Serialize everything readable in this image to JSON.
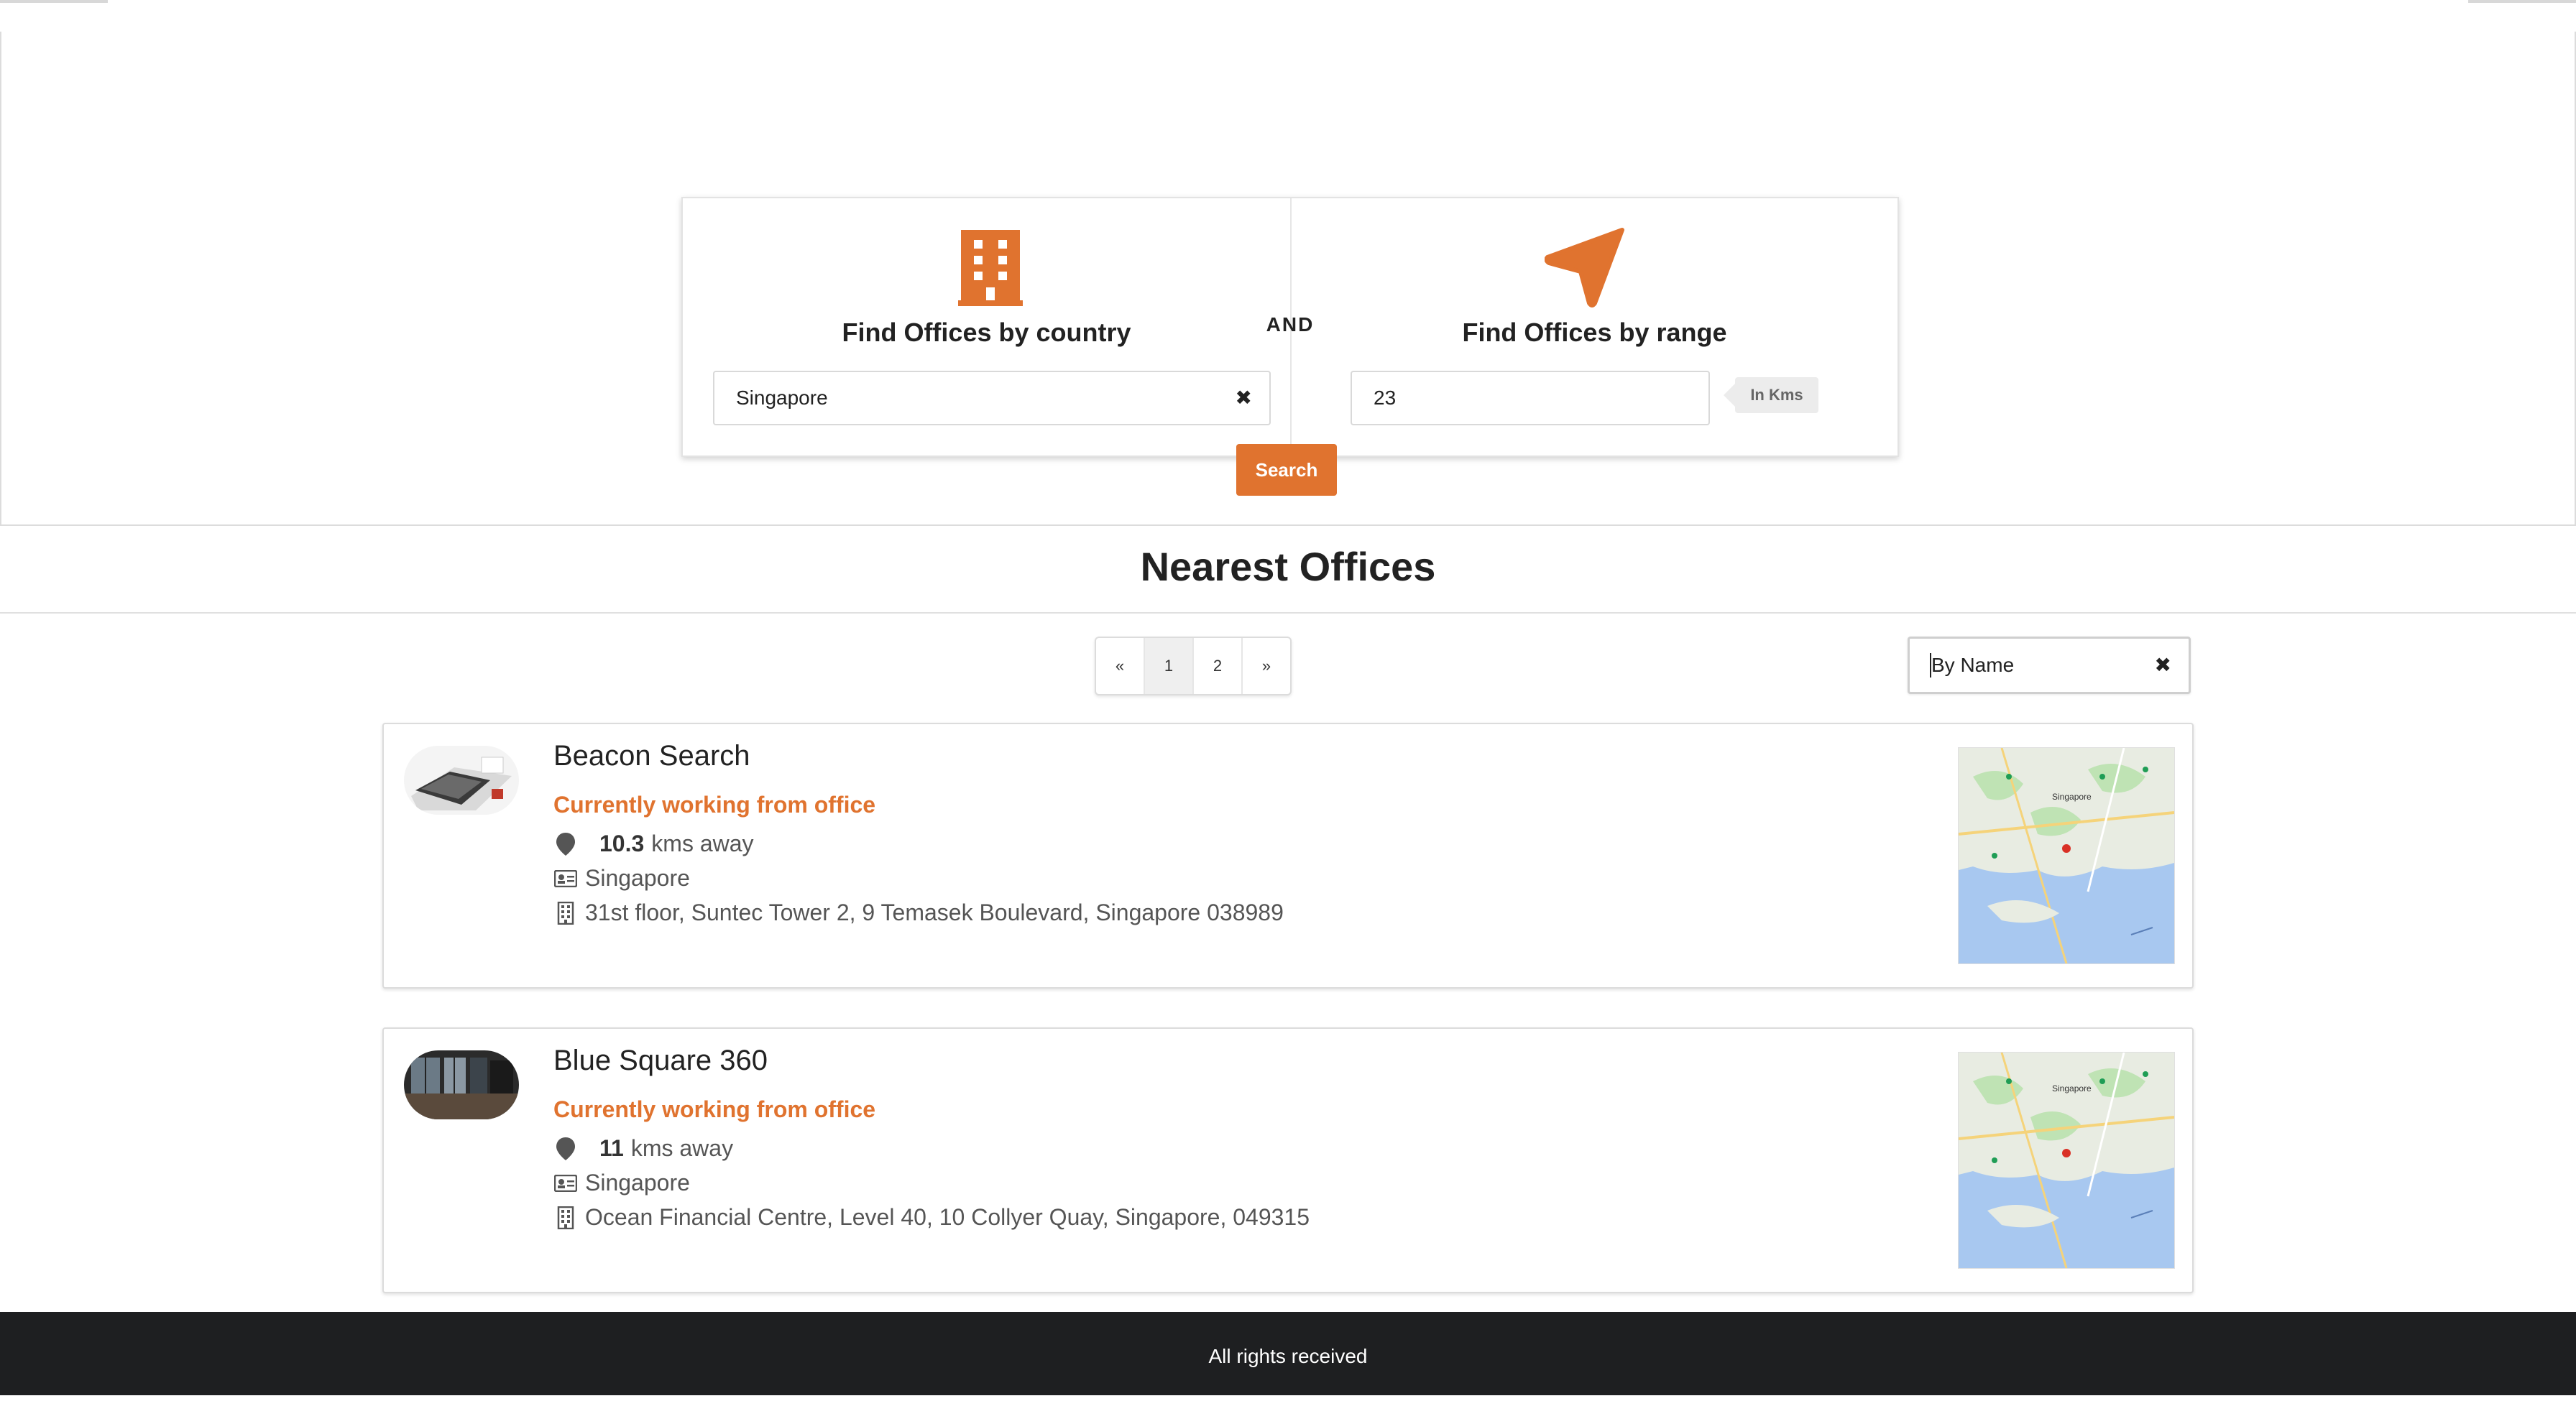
{
  "finder": {
    "country": {
      "title": "Find Offices by country",
      "value": "Singapore",
      "icon": "building-icon"
    },
    "connector": "AND",
    "range": {
      "title": "Find Offices by range",
      "value": "23",
      "unit": "In Kms",
      "icon": "navigation-arrow-icon"
    },
    "search_label": "Search",
    "clear_glyph": "✖"
  },
  "results": {
    "heading": "Nearest Offices",
    "pagination": [
      "«",
      "1",
      "2",
      "»"
    ],
    "active_page": "1",
    "sort": {
      "value": "By Name"
    },
    "offices": [
      {
        "name": "Beacon Search",
        "status": "Currently working from office",
        "distance": "10.3",
        "distance_suffix": "kms away",
        "country": "Singapore",
        "address": "31st floor, Suntec Tower 2, 9 Temasek Boulevard, Singapore 038989",
        "map_label": "Singapore"
      },
      {
        "name": "Blue Square 360",
        "status": "Currently working from office",
        "distance": "11",
        "distance_suffix": "kms away",
        "country": "Singapore",
        "address": "Ocean Financial Centre, Level 40, 10 Collyer Quay, Singapore, 049315",
        "map_label": "Singapore"
      }
    ]
  },
  "footer": {
    "text": "All rights received"
  },
  "colors": {
    "accent": "#e0732f",
    "footer_bg": "#1e1f21"
  }
}
